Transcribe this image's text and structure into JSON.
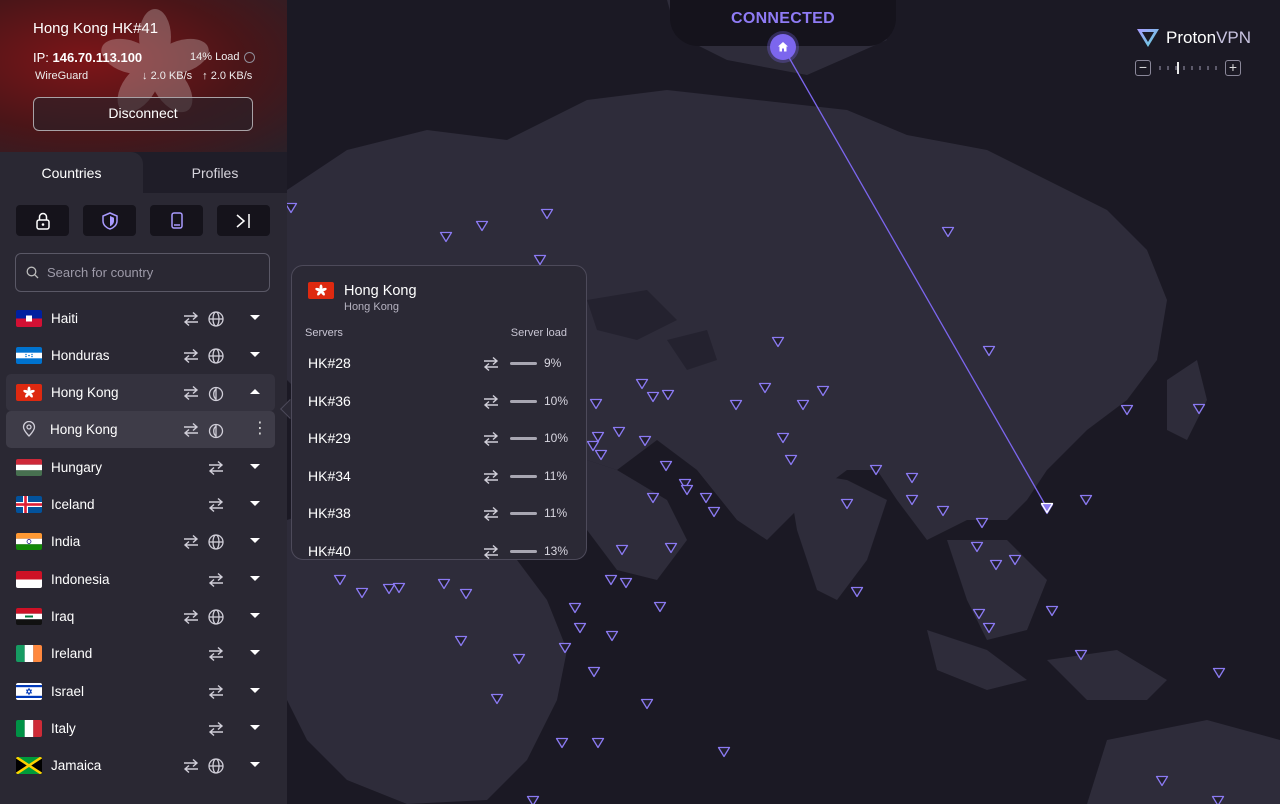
{
  "connection": {
    "server_name": "Hong Kong HK#41",
    "ip_label": "IP: ",
    "ip_value": "146.70.113.100",
    "load": "14% Load",
    "protocol": "WireGuard",
    "download": "2.0 KB/s",
    "upload": "2.0 KB/s",
    "disconnect_label": "Disconnect"
  },
  "status": {
    "label": "CONNECTED",
    "accent": "#8f7bf5"
  },
  "brand": {
    "word1": "Proton",
    "word2": "VPN"
  },
  "zoom": {
    "minus": "−",
    "plus": "+"
  },
  "tabs": {
    "countries": "Countries",
    "profiles": "Profiles"
  },
  "features": [
    "lock-icon",
    "shield-icon",
    "phone-icon",
    "tor-icon"
  ],
  "search": {
    "placeholder": "Search for country"
  },
  "countries": [
    {
      "name": "Haiti",
      "p2p": true,
      "tor": false,
      "streaming": true
    },
    {
      "name": "Honduras",
      "p2p": true,
      "tor": false,
      "streaming": true
    },
    {
      "name": "Hong Kong",
      "p2p": true,
      "tor": true,
      "streaming": false,
      "expanded": true
    },
    {
      "name": "Hong Kong",
      "sub": true
    },
    {
      "name": "Hungary",
      "p2p": true
    },
    {
      "name": "Iceland",
      "p2p": true
    },
    {
      "name": "India",
      "p2p": true,
      "streaming": true
    },
    {
      "name": "Indonesia",
      "p2p": true
    },
    {
      "name": "Iraq",
      "p2p": true,
      "streaming": true
    },
    {
      "name": "Ireland",
      "p2p": true
    },
    {
      "name": "Israel",
      "p2p": true
    },
    {
      "name": "Italy",
      "p2p": true
    },
    {
      "name": "Jamaica",
      "p2p": true,
      "streaming": true
    }
  ],
  "popup": {
    "country": "Hong Kong",
    "city": "Hong Kong",
    "servers_header": "Servers",
    "load_header": "Server load",
    "servers": [
      {
        "name": "HK#28",
        "load": "9%"
      },
      {
        "name": "HK#36",
        "load": "10%"
      },
      {
        "name": "HK#29",
        "load": "10%"
      },
      {
        "name": "HK#34",
        "load": "11%"
      },
      {
        "name": "HK#38",
        "load": "11%"
      },
      {
        "name": "HK#40",
        "load": "13%"
      }
    ]
  }
}
